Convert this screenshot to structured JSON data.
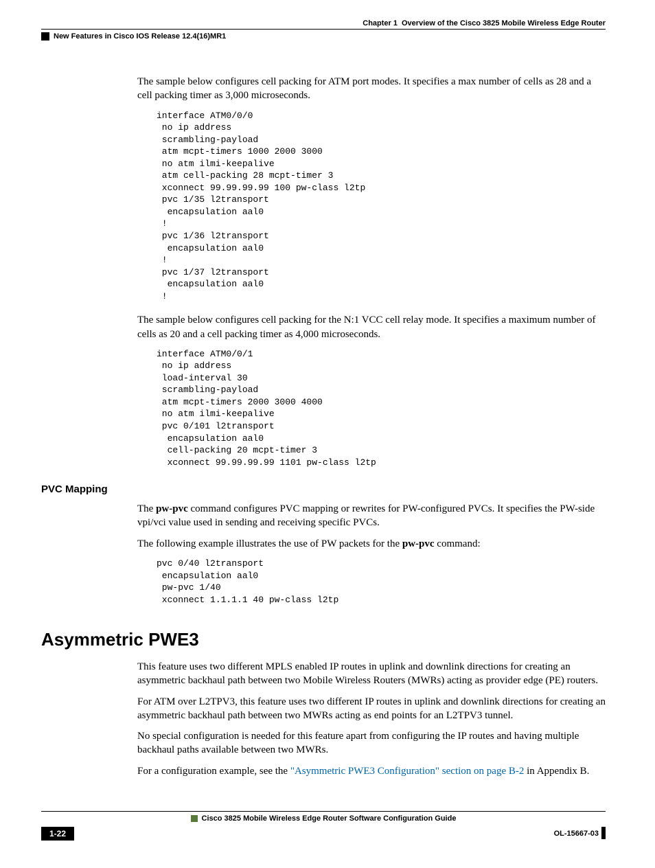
{
  "header": {
    "chapter_label": "Chapter 1",
    "chapter_title": "Overview of the Cisco 3825 Mobile Wireless Edge Router",
    "section": "New Features in Cisco IOS Release 12.4(16)MR1"
  },
  "para": {
    "p1": "The sample below configures cell packing for ATM port modes. It specifies a max number of cells as 28 and a cell packing timer as 3,000 microseconds.",
    "p2": "The sample below configures cell packing for the N:1 VCC cell relay mode. It specifies a maximum number of cells as 20 and a cell packing timer as 4,000 microseconds.",
    "p3a": "The ",
    "p3b": "pw-pvc",
    "p3c": " command configures PVC mapping or rewrites for PW-configured PVCs. It specifies the PW-side vpi/vci value used in sending and receiving specific PVCs.",
    "p4a": "The following example illustrates the use of PW packets for the ",
    "p4b": "pw-pvc",
    "p4c": " command:",
    "p5": "This feature uses two different MPLS enabled IP routes in uplink and downlink directions for creating an asymmetric backhaul path between two Mobile Wireless Routers (MWRs) acting as provider edge (PE) routers.",
    "p6": "For ATM over L2TPV3, this feature uses two different IP routes in uplink and downlink directions for creating an asymmetric backhaul path between two MWRs acting as end points for an L2TPV3 tunnel.",
    "p7": "No special configuration is needed for this feature apart from configuring the IP routes and having multiple backhaul paths available between two MWRs.",
    "p8a": "For a configuration example, see the ",
    "p8b": "\"Asymmetric PWE3 Configuration\" section on page B-2",
    "p8c": " in Appendix B."
  },
  "code": {
    "c1": "interface ATM0/0/0\n no ip address\n scrambling-payload\n atm mcpt-timers 1000 2000 3000\n no atm ilmi-keepalive\n atm cell-packing 28 mcpt-timer 3\n xconnect 99.99.99.99 100 pw-class l2tp\n pvc 1/35 l2transport\n  encapsulation aal0\n !\n pvc 1/36 l2transport\n  encapsulation aal0\n !\n pvc 1/37 l2transport\n  encapsulation aal0\n !",
    "c2": "interface ATM0/0/1\n no ip address\n load-interval 30\n scrambling-payload\n atm mcpt-timers 2000 3000 4000\n no atm ilmi-keepalive\n pvc 0/101 l2transport\n  encapsulation aal0\n  cell-packing 20 mcpt-timer 3\n  xconnect 99.99.99.99 1101 pw-class l2tp",
    "c3": "pvc 0/40 l2transport\n encapsulation aal0\n pw-pvc 1/40\n xconnect 1.1.1.1 40 pw-class l2tp"
  },
  "headings": {
    "h3_pvc": "PVC Mapping",
    "h2_asym": "Asymmetric PWE3"
  },
  "footer": {
    "guide_title": "Cisco 3825 Mobile Wireless Edge Router Software Configuration Guide",
    "page_num": "1-22",
    "doc_id": "OL-15667-03"
  }
}
